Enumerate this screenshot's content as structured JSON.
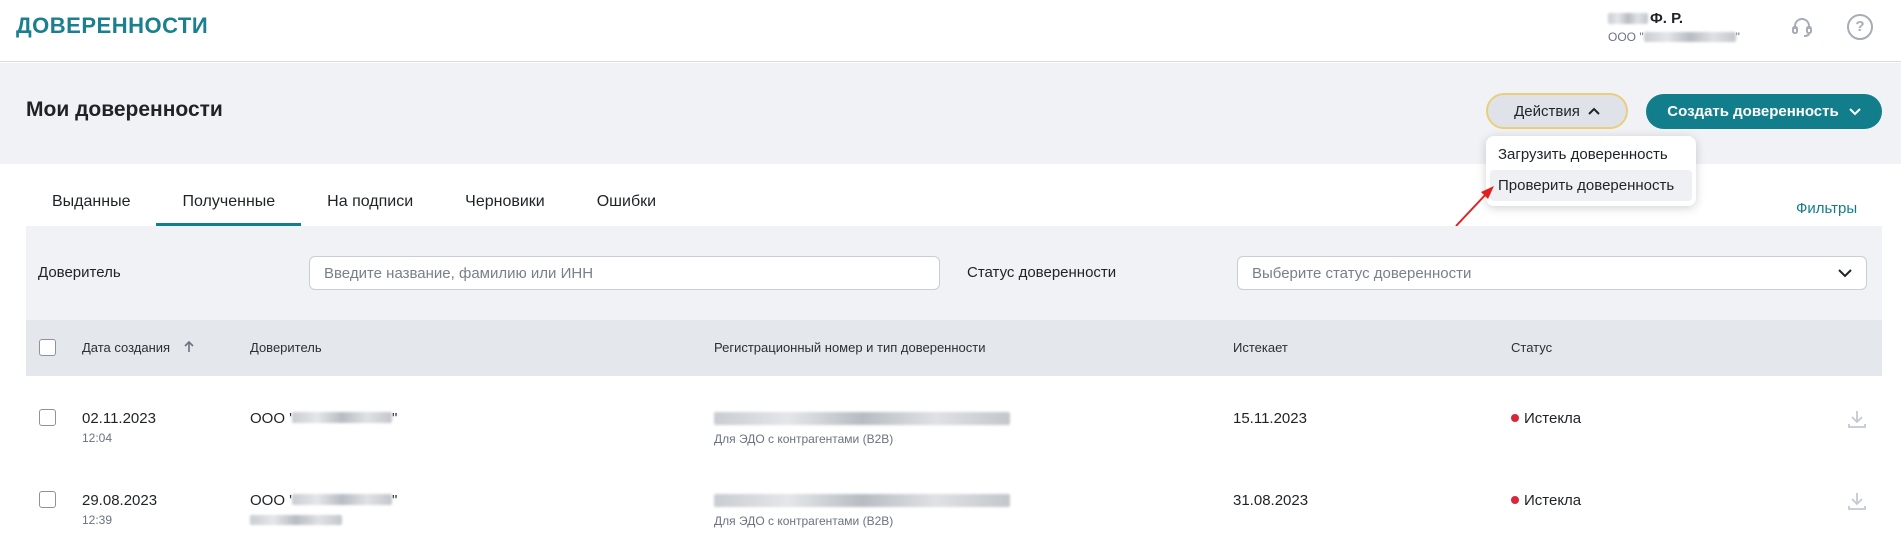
{
  "header": {
    "logo": "ДОВЕРЕННОСТИ",
    "user_name_suffix": "Ф. Р.",
    "user_org_prefix": "ООО \"",
    "user_org_suffix": "\"",
    "support_icon": "headset-icon",
    "help_icon": "question-icon"
  },
  "page": {
    "title": "Мои доверенности",
    "actions_label": "Действия",
    "create_label": "Создать доверенность"
  },
  "actions_menu": {
    "items": [
      {
        "label": "Загрузить доверенность"
      },
      {
        "label": "Проверить доверенность"
      }
    ]
  },
  "tabs": [
    {
      "label": "Выданные"
    },
    {
      "label": "Полученные"
    },
    {
      "label": "На подписи"
    },
    {
      "label": "Черновики"
    },
    {
      "label": "Ошибки"
    }
  ],
  "active_tab": "Полученные",
  "filters_link": "Фильтры",
  "filters": {
    "principal_label": "Доверитель",
    "principal_placeholder": "Введите название, фамилию или ИНН",
    "status_label": "Статус доверенности",
    "status_placeholder": "Выберите статус доверенности"
  },
  "table": {
    "columns": [
      "Дата создания",
      "Доверитель",
      "Регистрационный номер и тип доверенности",
      "Истекает",
      "Статус"
    ],
    "rows": [
      {
        "date": "02.11.2023",
        "time": "12:04",
        "principal_prefix": "ООО '",
        "principal_suffix": "\"",
        "type": "Для ЭДО с контрагентами (B2B)",
        "expires": "15.11.2023",
        "status": "Истекла"
      },
      {
        "date": "29.08.2023",
        "time": "12:39",
        "principal_prefix": "ООО '",
        "principal_suffix": "\"",
        "type": "Для ЭДО с контрагентами (B2B)",
        "expires": "31.08.2023",
        "status": "Истекла"
      }
    ]
  },
  "colors": {
    "brand": "#137e8b",
    "status_expired": "#d9263a",
    "annotation_arrow": "#e02020"
  }
}
